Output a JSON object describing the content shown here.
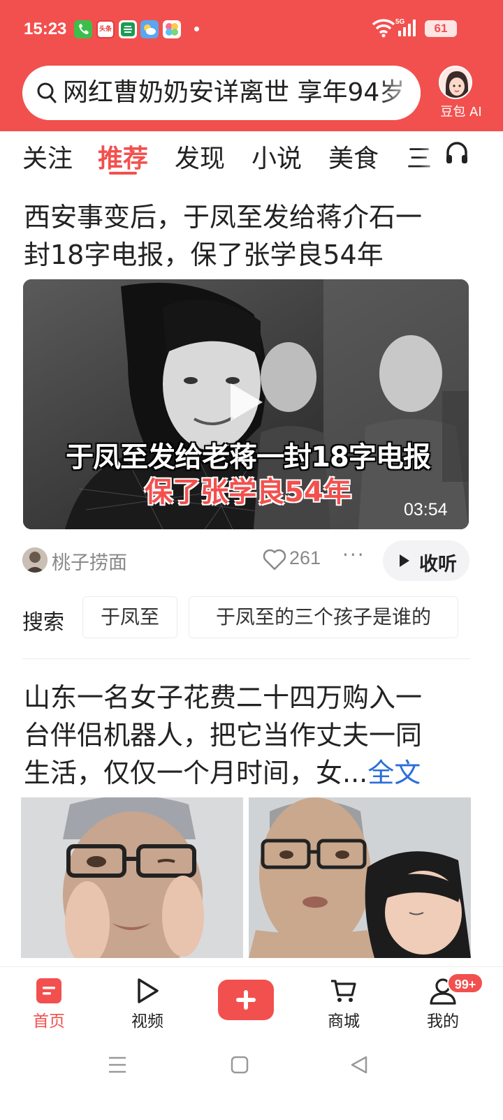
{
  "status_bar": {
    "time": "15:23",
    "app_icons": [
      "phone-icon",
      "toutiao-icon",
      "bank-icon",
      "weather-icon",
      "gallery-icon"
    ],
    "toutiao_icon_text": "头条",
    "network": "5G",
    "battery": "61"
  },
  "search": {
    "query": "网红曹奶奶安详离世 享年94岁"
  },
  "ai_button": {
    "label": "豆包 AI"
  },
  "tabs": [
    {
      "label": "关注",
      "active": false
    },
    {
      "label": "推荐",
      "active": true
    },
    {
      "label": "发现",
      "active": false
    },
    {
      "label": "小说",
      "active": false
    },
    {
      "label": "美食",
      "active": false
    },
    {
      "label": "三",
      "active": false
    }
  ],
  "article1": {
    "title_line1": "西安事变后，于凤至发给蒋介石一",
    "title_line2": "封18字电报，保了张学良54年",
    "video": {
      "caption_line1": "于凤至发给老蒋一封18字电报",
      "caption_line2": "保了张学良54年",
      "duration": "03:54"
    },
    "author": "桃子捞面",
    "likes": "261",
    "more": "···",
    "listen_label": "收听"
  },
  "related_search": {
    "label": "搜索",
    "chips": [
      "于凤至",
      "于凤至的三个孩子是谁的"
    ]
  },
  "article2": {
    "title_line1": "山东一名女子花费二十四万购入一",
    "title_line2": "台伴侣机器人，把它当作丈夫一同",
    "title_line3": "生活，仅仅一个月时间，女...",
    "full_text_link": "全文"
  },
  "bottom_nav": {
    "items": [
      {
        "label": "首页",
        "icon": "home-icon",
        "active": true
      },
      {
        "label": "视频",
        "icon": "video-icon",
        "active": false
      },
      {
        "label": "",
        "icon": "add-icon",
        "active": false
      },
      {
        "label": "商城",
        "icon": "cart-icon",
        "active": false
      },
      {
        "label": "我的",
        "icon": "user-icon",
        "active": false
      }
    ],
    "badge": "99+"
  },
  "colors": {
    "brand_red": "#f2504e",
    "link_blue": "#2a6dd9"
  }
}
